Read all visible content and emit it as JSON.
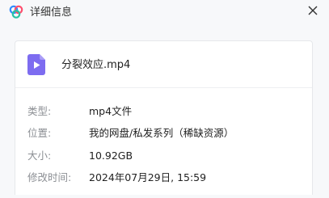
{
  "window": {
    "title": "详细信息",
    "close_icon": "close-icon",
    "logo_icon": "cloud-logo-icon"
  },
  "file": {
    "icon": "video-file-icon",
    "name": "分裂效应.mp4"
  },
  "details": [
    {
      "label": "类型:",
      "value": "mp4文件"
    },
    {
      "label": "位置:",
      "value": "我的网盘/私发系列（稀缺资源）"
    },
    {
      "label": "大小:",
      "value": "10.92GB"
    },
    {
      "label": "修改时间:",
      "value": "2024年07月29日, 15:59"
    }
  ],
  "colors": {
    "file_icon": "#7d6cf0",
    "logo_blue": "#2f8cff",
    "logo_pink": "#ff4d6d"
  }
}
